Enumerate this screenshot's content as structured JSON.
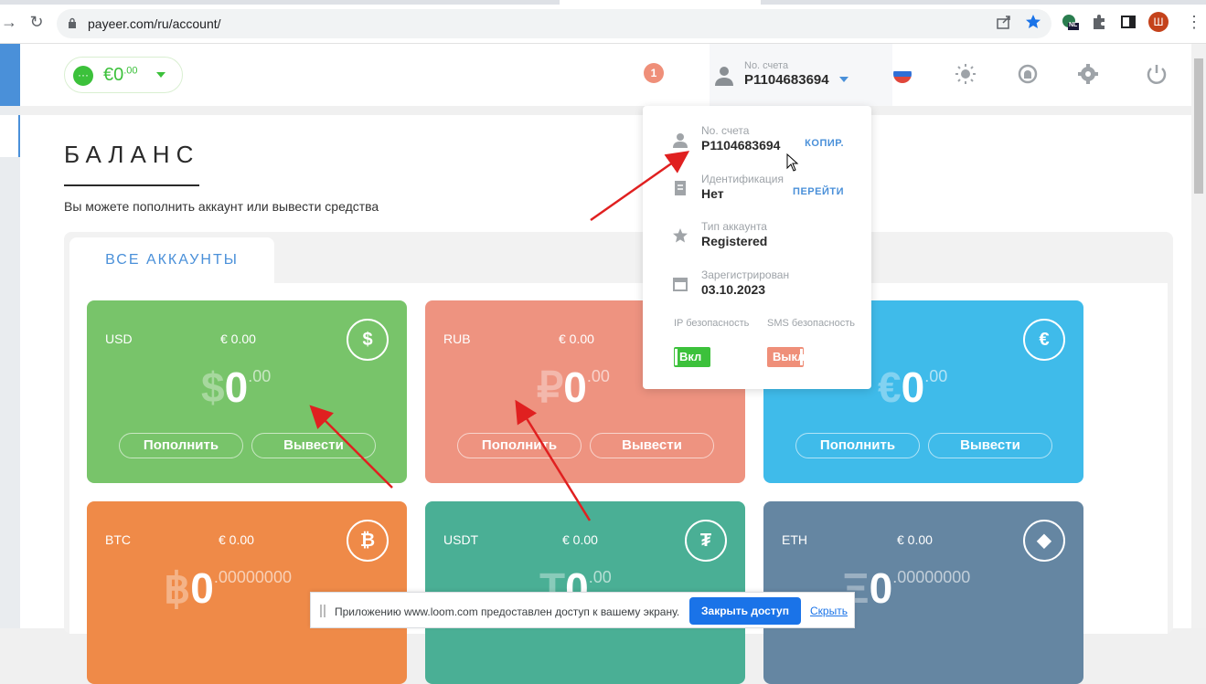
{
  "browser": {
    "url": "payeer.com/ru/account/",
    "profile_letter": "Ш",
    "ext_badge": "NL"
  },
  "header": {
    "wallet_symbol": "€0",
    "wallet_cents": ".00",
    "notification_count": "1",
    "account_label": "No. счета",
    "account_number": "P1104683694"
  },
  "page": {
    "title": "БАЛАНС",
    "subtitle": "Вы можете пополнить аккаунт или вывести средства",
    "tab_all": "ВСЕ АККАУНТЫ"
  },
  "cards": [
    {
      "currency": "USD",
      "eur": "€ 0.00",
      "icon": "$",
      "symbol": "$",
      "amount": "0",
      "cents": ".00",
      "btn_deposit": "Пополнить",
      "btn_withdraw": "Вывести",
      "color": "#78c46a"
    },
    {
      "currency": "RUB",
      "eur": "€ 0.00",
      "icon": "₽",
      "symbol": "₽",
      "amount": "0",
      "cents": ".00",
      "btn_deposit": "Пополнить",
      "btn_withdraw": "Вывести",
      "color": "#ee9380"
    },
    {
      "currency": "",
      "eur": "",
      "icon": "€",
      "symbol": "€",
      "amount": "0",
      "cents": ".00",
      "btn_deposit": "Пополнить",
      "btn_withdraw": "Вывести",
      "color": "#3fbbea"
    },
    {
      "currency": "BTC",
      "eur": "€ 0.00",
      "icon": "₿",
      "symbol": "฿",
      "amount": "0",
      "cents": ".00000000",
      "color": "#ef8a48"
    },
    {
      "currency": "USDT",
      "eur": "€ 0.00",
      "icon": "₮",
      "symbol": "T",
      "amount": "0",
      "cents": ".00",
      "color": "#4aaf95"
    },
    {
      "currency": "ETH",
      "eur": "€ 0.00",
      "icon": "◆",
      "symbol": "Ξ",
      "amount": "0",
      "cents": ".00000000",
      "color": "#6586a2"
    }
  ],
  "dropdown": {
    "account_label": "No. счета",
    "account_value": "P1104683694",
    "copy_action": "КОПИР.",
    "id_label": "Идентификация",
    "id_value": "Нет",
    "id_action": "ПЕРЕЙТИ",
    "type_label": "Тип аккаунта",
    "type_value": "Registered",
    "reg_label": "Зарегистрирован",
    "reg_value": "03.10.2023",
    "ip_label": "IP безопасность",
    "ip_state": "Вкл",
    "sms_label": "SMS безопасность",
    "sms_state": "Выкл"
  },
  "share_bar": {
    "message": "Приложению www.loom.com предоставлен доступ к вашему экрану.",
    "stop_button": "Закрыть доступ",
    "hide_link": "Скрыть"
  },
  "colors": {
    "accent": "#4a90d9",
    "green": "#3cc13b",
    "annotation_arrow": "#e02020"
  }
}
